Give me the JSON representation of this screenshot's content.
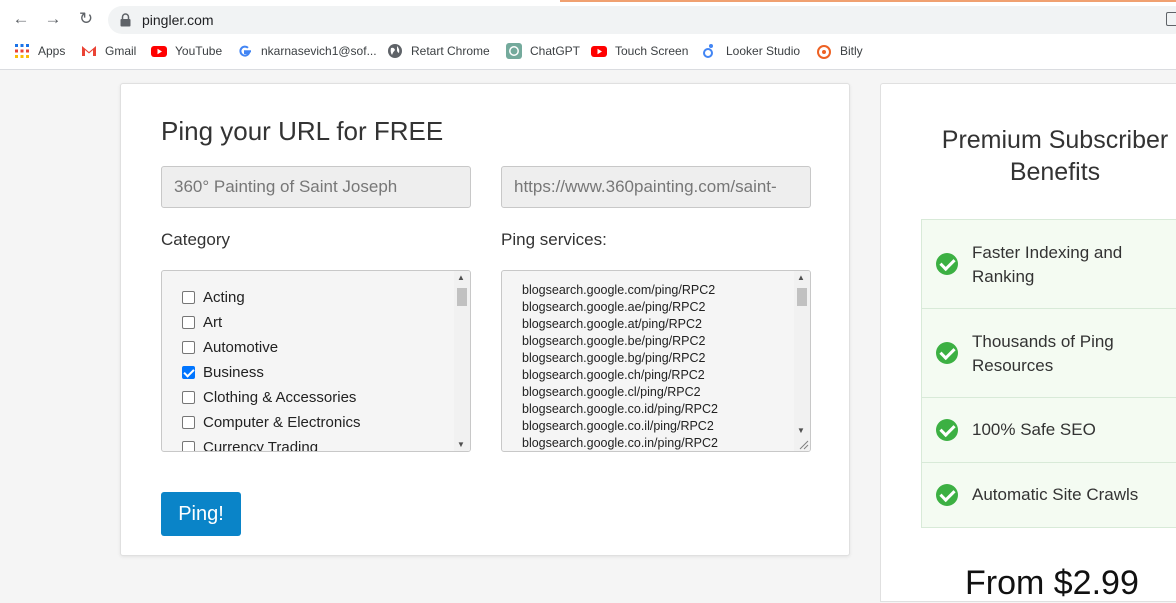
{
  "browser": {
    "url": "pingler.com",
    "bookmarks": [
      {
        "label": "Apps",
        "icon": "apps-grid-icon"
      },
      {
        "label": "Gmail",
        "icon": "gmail-icon"
      },
      {
        "label": "YouTube",
        "icon": "youtube-icon"
      },
      {
        "label": "nkarnasevich1@sof...",
        "icon": "google-icon"
      },
      {
        "label": "Retart Chrome",
        "icon": "globe-icon"
      },
      {
        "label": "ChatGPT",
        "icon": "chatgpt-icon"
      },
      {
        "label": "Touch Screen",
        "icon": "youtube-icon"
      },
      {
        "label": "Looker Studio",
        "icon": "looker-studio-icon"
      },
      {
        "label": "Bitly",
        "icon": "bitly-icon"
      }
    ]
  },
  "form": {
    "title": "Ping your URL for FREE",
    "title_input_value": "360° Painting of Saint Joseph",
    "url_input_value": "https://www.360painting.com/saint-",
    "category_label": "Category",
    "ping_services_label": "Ping services:",
    "categories": [
      {
        "label": "Acting",
        "checked": false
      },
      {
        "label": "Art",
        "checked": false
      },
      {
        "label": "Automotive",
        "checked": false
      },
      {
        "label": "Business",
        "checked": true
      },
      {
        "label": "Clothing & Accessories",
        "checked": false
      },
      {
        "label": "Computer & Electronics",
        "checked": false
      },
      {
        "label": "Currency Trading",
        "checked": false
      }
    ],
    "ping_services": [
      "blogsearch.google.com/ping/RPC2",
      "blogsearch.google.ae/ping/RPC2",
      "blogsearch.google.at/ping/RPC2",
      "blogsearch.google.be/ping/RPC2",
      "blogsearch.google.bg/ping/RPC2",
      "blogsearch.google.ch/ping/RPC2",
      "blogsearch.google.cl/ping/RPC2",
      "blogsearch.google.co.id/ping/RPC2",
      "blogsearch.google.co.il/ping/RPC2",
      "blogsearch.google.co.in/ping/RPC2"
    ],
    "ping_button_label": "Ping!"
  },
  "premium": {
    "title": "Premium Subscriber Benefits",
    "benefits": [
      "Faster Indexing and Ranking",
      "Thousands of Ping Resources",
      "100% Safe SEO",
      "Automatic Site Crawls"
    ],
    "price": "From $2.99"
  },
  "colors": {
    "ping_button": "#0a84c8",
    "check_green": "#3cb043",
    "checkbox_checked": "#0075ff"
  }
}
